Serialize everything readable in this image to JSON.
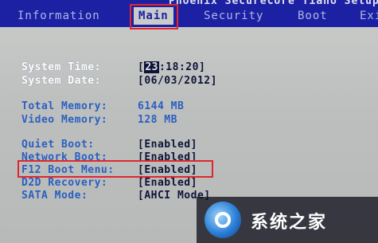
{
  "header": {
    "vendor_title": "Phoenix SecureCore Tiano Setup",
    "tabs": [
      {
        "label": "Information",
        "active": false
      },
      {
        "label": "Main",
        "active": true
      },
      {
        "label": "Security",
        "active": false
      },
      {
        "label": "Boot",
        "active": false
      },
      {
        "label": "Exit",
        "active": false
      }
    ]
  },
  "main": {
    "system_time": {
      "label": "System Time:",
      "cursor": "23",
      "rest": ":18:20]",
      "open": "["
    },
    "system_date": {
      "label": "System Date:",
      "value": "[06/03/2012]"
    },
    "total_memory": {
      "label": "Total Memory:",
      "value": "6144 MB"
    },
    "video_memory": {
      "label": "Video Memory:",
      "value": "128 MB"
    },
    "quiet_boot": {
      "label": "Quiet Boot:",
      "value": "[Enabled]"
    },
    "network_boot": {
      "label": "Network Boot:",
      "value": "[Enabled]"
    },
    "f12_boot_menu": {
      "label": "F12 Boot Menu:",
      "value": "[Enabled]"
    },
    "d2d_recovery": {
      "label": "D2D Recovery:",
      "value": "[Enabled]"
    },
    "sata_mode": {
      "label": "SATA Mode:",
      "value": "[AHCI Mode]"
    }
  },
  "watermark": {
    "text": "系统之家"
  },
  "colors": {
    "bar_blue": "#1c20a3",
    "panel_gray": "#c8cbc9",
    "highlight_red": "#e2262e",
    "label_white": "#ffffff",
    "value_blue": "#2a5fc0"
  }
}
